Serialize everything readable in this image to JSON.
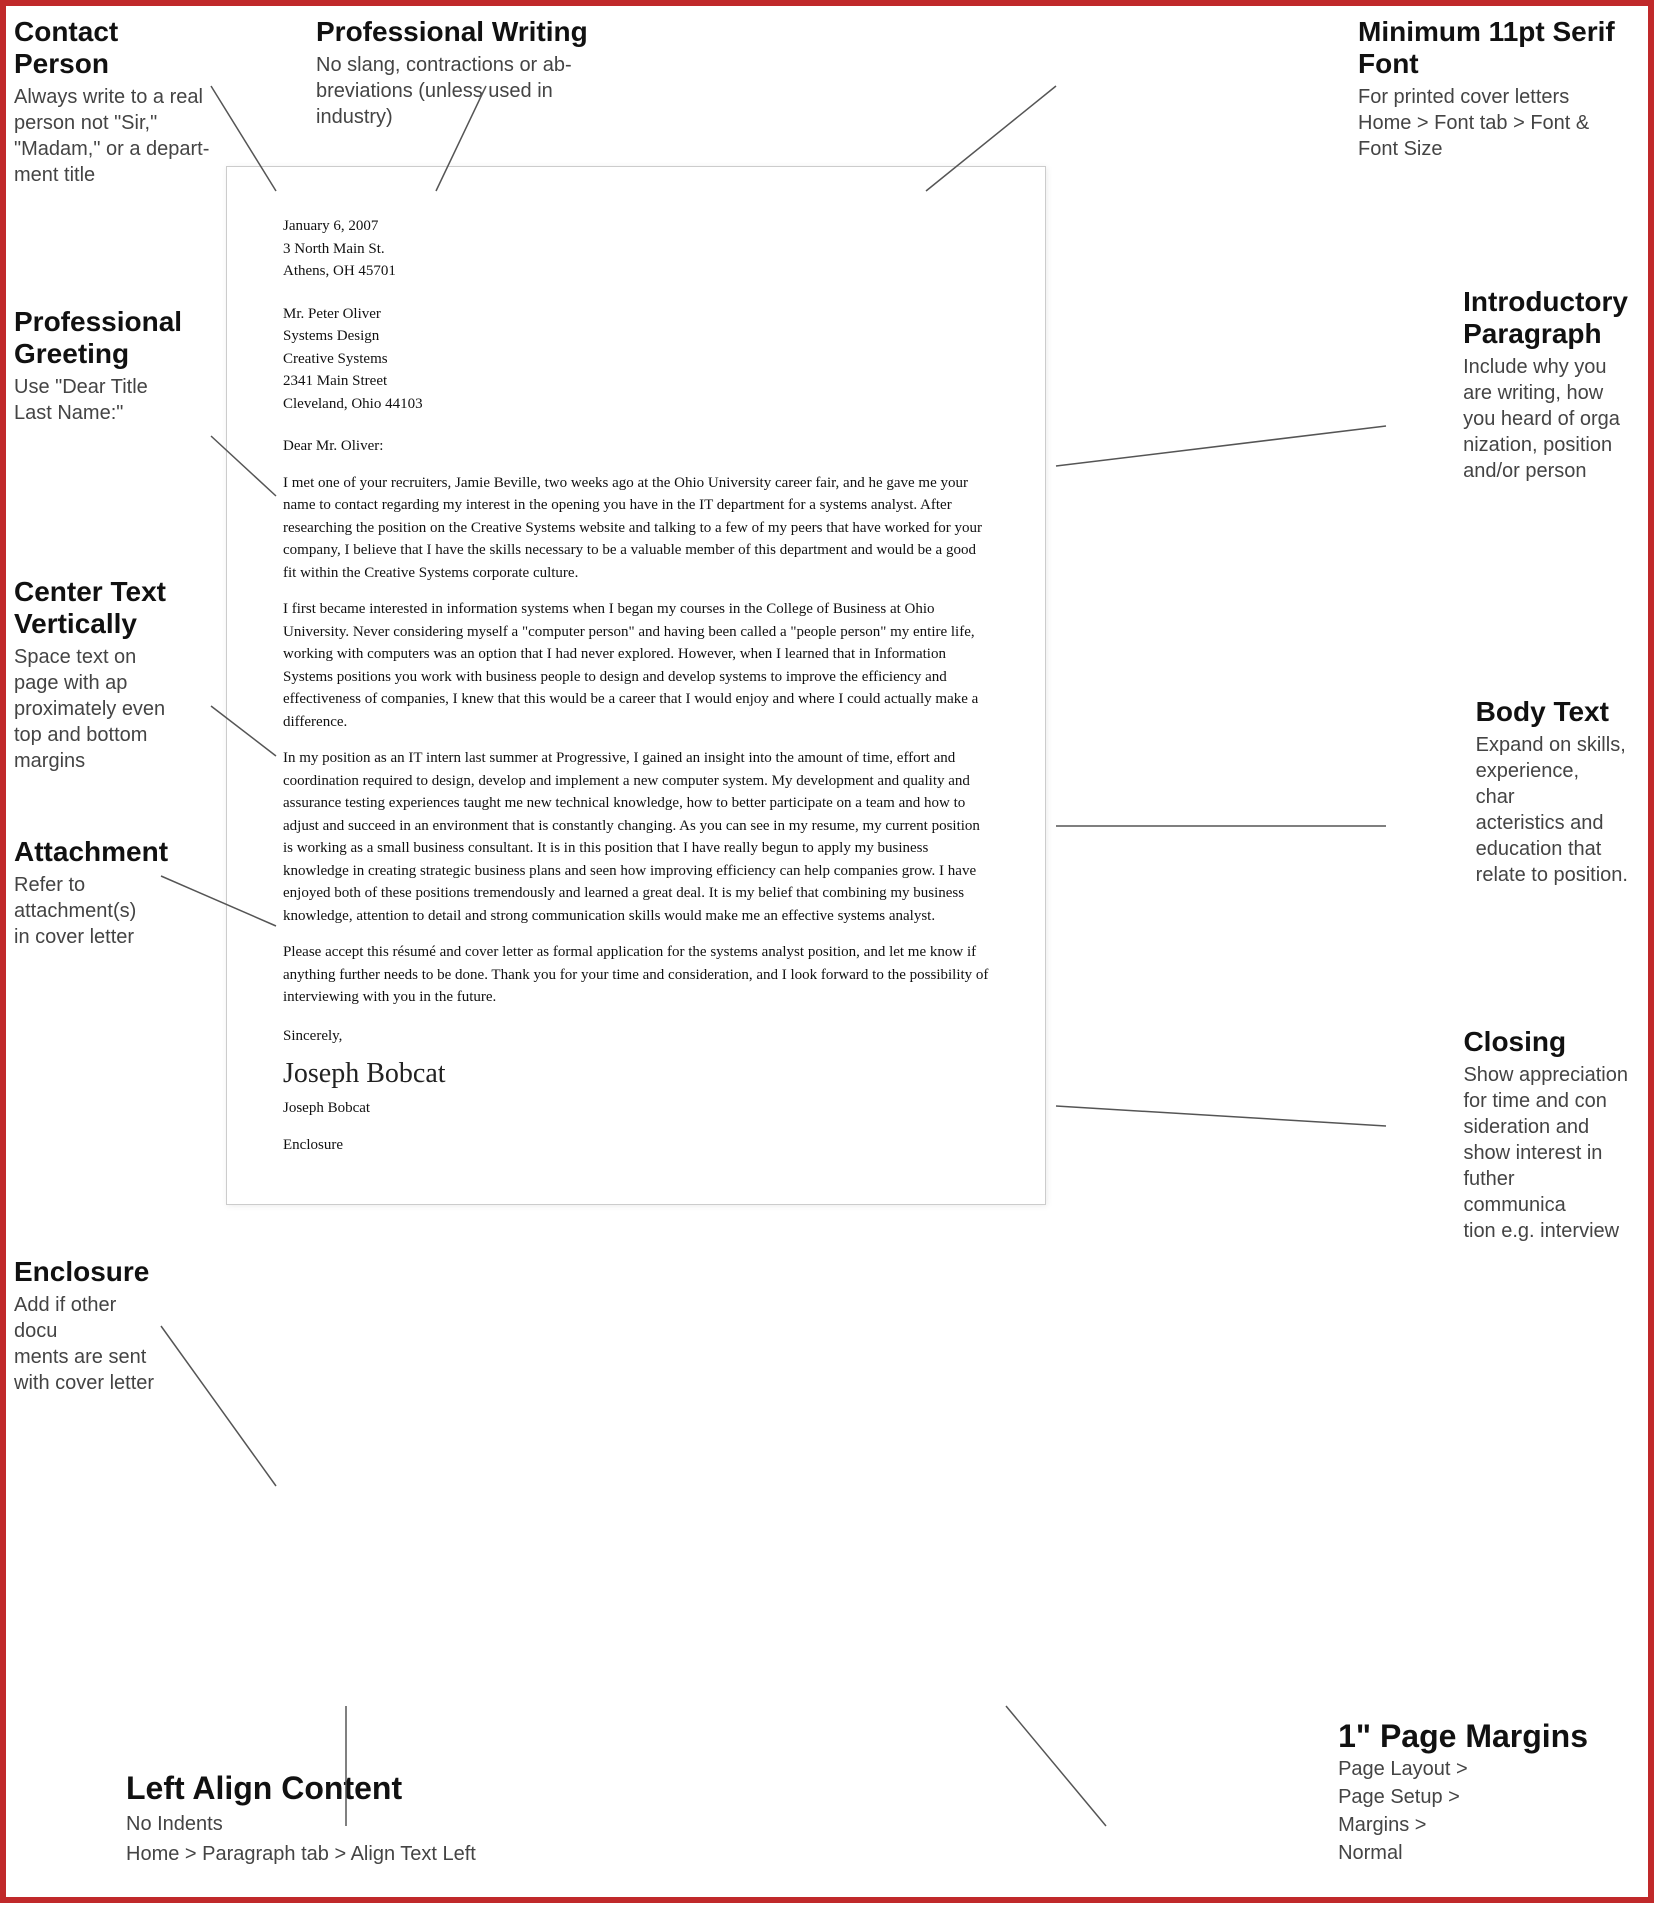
{
  "annotations": {
    "contact_person": {
      "title": "Contact Person",
      "body": "Always write to a real person not \"Sir,\" \"Madam,\" or a depart­ment title"
    },
    "professional_writing": {
      "title": "Professional Writing",
      "body": "No slang, contractions or ab­breviations (unless used in industry)"
    },
    "minimum_font": {
      "title": "Minimum 11pt Serif Font",
      "body": "For printed cover letters\nHome > Font tab > Font & Font Size"
    },
    "professional_greeting": {
      "title": "Professional\nGreeting",
      "body": "Use \"Dear Title\nLast Name:\""
    },
    "center_text": {
      "title": "Center Text\nVertically",
      "body": "Space text on\npage with ap­\nproximately even\ntop and bottom\nmargins"
    },
    "attachment": {
      "title": "Attachment",
      "body": "Refer to\nattachment(s)\nin cover letter"
    },
    "enclosure": {
      "title": "Enclosure",
      "body": "Add if other docu­\nments are sent\nwith cover letter"
    },
    "introductory": {
      "title": "Introductory\nParagraph",
      "body": "Include why you\nare writing, how\nyou heard of orga­\nnization, position\nand/or person"
    },
    "body_text": {
      "title": "Body Text",
      "body": "Expand on skills,\nexperience, char­\nacteristics and\neducation that\nrelate to position."
    },
    "closing": {
      "title": "Closing",
      "body": "Show appreciation\nfor time and con­\nsideration and\nshow interest in\nfuther communica­\ntion e.g. interview"
    },
    "left_align": {
      "title": "Left Align Content",
      "subtitle": "No Indents",
      "instruction": "Home > Paragraph tab > Align Text Left"
    },
    "page_margins": {
      "title": "1\" Page Margins",
      "instructions": [
        "Page Layout >",
        "Page Setup >",
        "Margins >",
        "Normal"
      ]
    }
  },
  "letter": {
    "date": "January 6, 2007",
    "sender_address": [
      "3 North Main St.",
      "Athens, OH 45701"
    ],
    "recipient": {
      "name": "Mr. Peter Oliver",
      "title": "Systems Design",
      "company": "Creative Systems",
      "street": "2341 Main Street",
      "city": "Cleveland, Ohio  44103"
    },
    "salutation": "Dear Mr. Oliver:",
    "paragraphs": [
      "I met one of your recruiters, Jamie Beville, two weeks ago at the Ohio University career fair, and he gave me your name to contact regarding my interest in the opening you have in the IT department for a systems analyst. After researching the position on the Creative Systems website and talking to a few of my peers that have worked for your company, I believe that I have the skills necessary to be a valuable member of this department and would be a good fit within the Creative Systems corporate culture.",
      "I first became interested in information systems when I began my courses in the College of Business at Ohio University. Never considering myself a \"computer person\" and having been called a \"people person\" my entire life, working with computers was an option that I had never explored. However, when I learned that in Information Systems positions you work with business people to design and develop systems to improve the efficiency and effectiveness of companies, I knew that this would be a career that I would enjoy and where I could actually make a difference.",
      "In my position as an IT intern last summer at Progressive, I gained an insight into the amount of time, effort and coordination required to design, develop and implement a new computer system. My development and quality and assurance testing experiences taught me new technical knowledge, how to better participate on a team and how to adjust and succeed in an environment that is constantly changing. As you can see in my resume, my current position is working as a small business consultant. It is in this position that I have really begun to apply my business knowledge in creating strategic business plans and seen how improving efficiency can help companies grow. I have enjoyed both of these positions tremendously and learned a great deal. It is my belief that combining my business knowledge, attention to detail and strong communication skills would make me an effective systems analyst.",
      "Please accept this résumé and cover letter as formal application for the systems analyst position, and let me know if anything further needs to be done. Thank you for your time and consideration, and I look forward to the possibility of interviewing with you in the future."
    ],
    "closing_word": "Sincerely,",
    "signature": "Joseph Bobcat",
    "typed_name": "Joseph Bobcat",
    "enclosure": "Enclosure"
  }
}
